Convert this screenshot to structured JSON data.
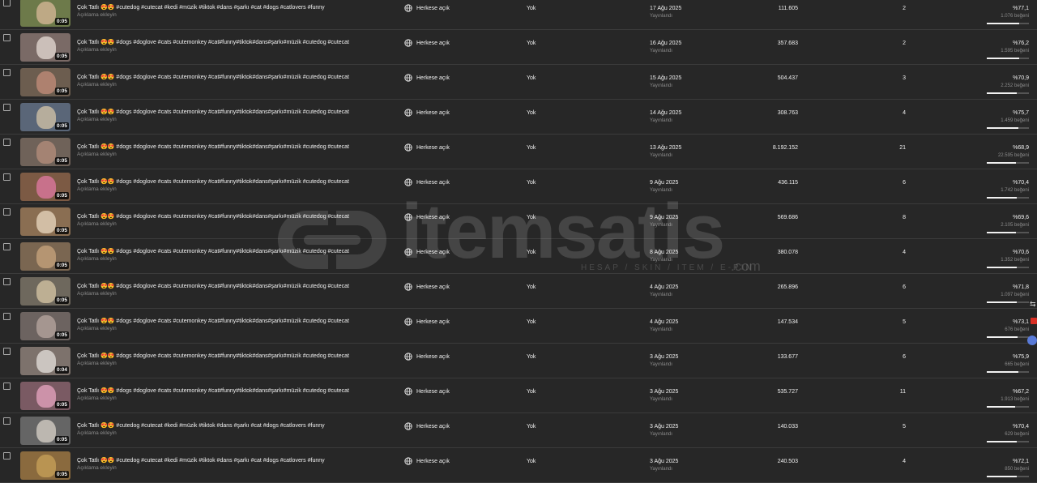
{
  "videos": [
    {
      "title": "Çok Tatlı 😍😍 #cutedog #cutecat #kedi #müzik #tiktok #dans #şarkı #cat #dogs #catlovers #funny",
      "description_placeholder": "Açıklama ekleyin",
      "duration": "0:05",
      "visibility": "Herkese açık",
      "restrictions": "Yok",
      "date": "17 Ağu 2025",
      "date_status": "Yayınlandı",
      "views": "111.605",
      "comments": "2",
      "like_ratio": "%77,1",
      "likes": "1.076 beğeni",
      "like_fraction": 0.771,
      "thumb_color": "#6d7a4a",
      "blob_color": "#d9b99a"
    },
    {
      "title": "Çok Tatlı 😍😍 #dogs #doglove #cats #cutemonkey #cat#funny#tiktok#dans#şarkı#müzik #cutedog #cutecat",
      "description_placeholder": "Açıklama ekleyin",
      "duration": "0:05",
      "visibility": "Herkese açık",
      "restrictions": "Yok",
      "date": "16 Ağu 2025",
      "date_status": "Yayınlandı",
      "views": "357.683",
      "comments": "2",
      "like_ratio": "%76,2",
      "likes": "1.595 beğeni",
      "like_fraction": 0.762,
      "thumb_color": "#7a6a66",
      "blob_color": "#e7dcd6"
    },
    {
      "title": "Çok Tatlı 😍😍 #dogs #doglove #cats #cutemonkey #cat#funny#tiktok#dans#şarkı#müzik #cutedog #cutecat",
      "description_placeholder": "Açıklama ekleyin",
      "duration": "0:05",
      "visibility": "Herkese açık",
      "restrictions": "Yok",
      "date": "15 Ağu 2025",
      "date_status": "Yayınlandı",
      "views": "504.437",
      "comments": "3",
      "like_ratio": "%70,9",
      "likes": "2.252 beğeni",
      "like_fraction": 0.709,
      "thumb_color": "#6c5d4f",
      "blob_color": "#c48d7a"
    },
    {
      "title": "Çok Tatlı 😍😍 #dogs #doglove #cats #cutemonkey #cat#funny#tiktok#dans#şarkı#müzik #cutedog #cutecat",
      "description_placeholder": "Açıklama ekleyin",
      "duration": "0:05",
      "visibility": "Herkese açık",
      "restrictions": "Yok",
      "date": "14 Ağu 2025",
      "date_status": "Yayınlandı",
      "views": "308.763",
      "comments": "4",
      "like_ratio": "%75,7",
      "likes": "1.459 beğeni",
      "like_fraction": 0.757,
      "thumb_color": "#5a6678",
      "blob_color": "#d6c6a8"
    },
    {
      "title": "Çok Tatlı 😍😍 #dogs #doglove #cats #cutemonkey #cat#funny#tiktok#dans#şarkı#müzik #cutedog #cutecat",
      "description_placeholder": "Açıklama ekleyin",
      "duration": "0:05",
      "visibility": "Herkese açık",
      "restrictions": "Yok",
      "date": "13 Ağu 2025",
      "date_status": "Yayınlandı",
      "views": "8.192.152",
      "comments": "21",
      "like_ratio": "%68,9",
      "likes": "22.595 beğeni",
      "like_fraction": 0.689,
      "thumb_color": "#6f6259",
      "blob_color": "#b58f7c"
    },
    {
      "title": "Çok Tatlı 😍😍 #dogs #doglove #cats #cutemonkey #cat#funny#tiktok#dans#şarkı#müzik #cutedog #cutecat",
      "description_placeholder": "Açıklama ekleyin",
      "duration": "0:05",
      "visibility": "Herkese açık",
      "restrictions": "Yok",
      "date": "9 Ağu 2025",
      "date_status": "Yayınlandı",
      "views": "436.115",
      "comments": "6",
      "like_ratio": "%70,4",
      "likes": "1.742 beğeni",
      "like_fraction": 0.704,
      "thumb_color": "#7c5a44",
      "blob_color": "#e27aa3"
    },
    {
      "title": "Çok Tatlı 😍😍 #dogs #doglove #cats #cutemonkey #cat#funny#tiktok#dans#şarkı#müzik #cutedog #cutecat",
      "description_placeholder": "Açıklama ekleyin",
      "duration": "0:05",
      "visibility": "Herkese açık",
      "restrictions": "Yok",
      "date": "9 Ağu 2025",
      "date_status": "Yayınlandı",
      "views": "569.686",
      "comments": "8",
      "like_ratio": "%69,6",
      "likes": "2.105 beğeni",
      "like_fraction": 0.696,
      "thumb_color": "#8a6e52",
      "blob_color": "#e9d9c2"
    },
    {
      "title": "Çok Tatlı 😍😍 #dogs #doglove #cats #cutemonkey #cat#funny#tiktok#dans#şarkı#müzik #cutedog #cutecat",
      "description_placeholder": "Açıklama ekleyin",
      "duration": "0:05",
      "visibility": "Herkese açık",
      "restrictions": "Yok",
      "date": "8 Ağu 2025",
      "date_status": "Yayınlandı",
      "views": "380.078",
      "comments": "4",
      "like_ratio": "%70,6",
      "likes": "1.352 beğeni",
      "like_fraction": 0.706,
      "thumb_color": "#7a6651",
      "blob_color": "#c9a57d"
    },
    {
      "title": "Çok Tatlı 😍😍 #dogs #doglove #cats #cutemonkey #cat#funny#tiktok#dans#şarkı#müzik #cutedog #cutecat",
      "description_placeholder": "Açıklama ekleyin",
      "duration": "0:05",
      "visibility": "Herkese açık",
      "restrictions": "Yok",
      "date": "4 Ağu 2025",
      "date_status": "Yayınlandı",
      "views": "265.896",
      "comments": "6",
      "like_ratio": "%71,8",
      "likes": "1.097 beğeni",
      "like_fraction": 0.718,
      "thumb_color": "#6e685d",
      "blob_color": "#d8c7a6"
    },
    {
      "title": "Çok Tatlı 😍😍 #dogs #doglove #cats #cutemonkey #cat#funny#tiktok#dans#şarkı#müzik #cutedog #cutecat",
      "description_placeholder": "Açıklama ekleyin",
      "duration": "0:05",
      "visibility": "Herkese açık",
      "restrictions": "Yok",
      "date": "4 Ağu 2025",
      "date_status": "Yayınlandı",
      "views": "147.534",
      "comments": "5",
      "like_ratio": "%73,1",
      "likes": "676 beğeni",
      "like_fraction": 0.731,
      "thumb_color": "#6c6360",
      "blob_color": "#b8a7a0"
    },
    {
      "title": "Çok Tatlı 😍😍 #dogs #doglove #cats #cutemonkey #cat#funny#tiktok#dans#şarkı#müzik #cutedog #cutecat",
      "description_placeholder": "Açıklama ekleyin",
      "duration": "0:04",
      "visibility": "Herkese açık",
      "restrictions": "Yok",
      "date": "3 Ağu 2025",
      "date_status": "Yayınlandı",
      "views": "133.677",
      "comments": "6",
      "like_ratio": "%75,9",
      "likes": "665 beğeni",
      "like_fraction": 0.759,
      "thumb_color": "#7d726c",
      "blob_color": "#e6e1dc"
    },
    {
      "title": "Çok Tatlı 😍😍 #dogs #doglove #cats #cutemonkey #cat#funny#tiktok#dans#şarkı#müzik #cutedog #cutecat",
      "description_placeholder": "Açıklama ekleyin",
      "duration": "0:05",
      "visibility": "Herkese açık",
      "restrictions": "Yok",
      "date": "3 Ağu 2025",
      "date_status": "Yayınlandı",
      "views": "535.727",
      "comments": "11",
      "like_ratio": "%67,2",
      "likes": "1.913 beğeni",
      "like_fraction": 0.672,
      "thumb_color": "#7a5a63",
      "blob_color": "#e8a6c0"
    },
    {
      "title": "Çok Tatlı 😍😍 #cutedog #cutecat #kedi #müzik #tiktok #dans #şarkı #cat #dogs #catlovers #funny",
      "description_placeholder": "Açıklama ekleyin",
      "duration": "0:05",
      "visibility": "Herkese açık",
      "restrictions": "Yok",
      "date": "3 Ağu 2025",
      "date_status": "Yayınlandı",
      "views": "140.033",
      "comments": "5",
      "like_ratio": "%70,4",
      "likes": "629 beğeni",
      "like_fraction": 0.704,
      "thumb_color": "#656565",
      "blob_color": "#d9d3c9"
    },
    {
      "title": "Çok Tatlı 😍😍 #cutedog #cutecat #kedi #müzik #tiktok #dans #şarkı #cat #dogs #catlovers #funny",
      "description_placeholder": "Açıklama ekleyin",
      "duration": "0:05",
      "visibility": "Herkese açık",
      "restrictions": "Yok",
      "date": "3 Ağu 2025",
      "date_status": "Yayınlandı",
      "views": "240.503",
      "comments": "4",
      "like_ratio": "%72,1",
      "likes": "850 beğeni",
      "like_fraction": 0.721,
      "thumb_color": "#8a6a3e",
      "blob_color": "#c8a35a"
    }
  ],
  "watermark": {
    "brand": "itemsatis",
    "tagline": "HESAP / SKIN / ITEM / E-PIN",
    "domain_suffix": ".com"
  }
}
